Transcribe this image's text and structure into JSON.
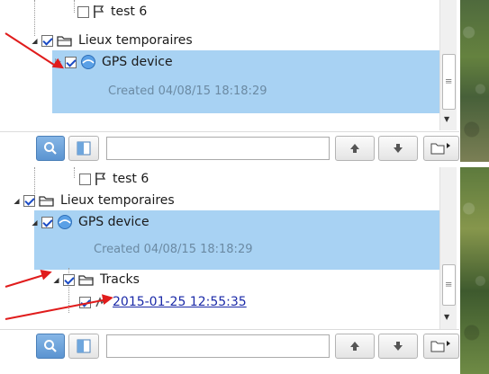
{
  "top": {
    "items": [
      {
        "label": "test 6",
        "checked": false
      },
      {
        "label": "Lieux temporaires",
        "checked": true
      },
      {
        "label": "GPS device",
        "checked": true,
        "subtitle": "Created 04/08/15 18:18:29"
      }
    ]
  },
  "bottom": {
    "items": [
      {
        "label": "test 6",
        "checked": false
      },
      {
        "label": "Lieux temporaires",
        "checked": true
      },
      {
        "label": "GPS device",
        "checked": true,
        "subtitle": "Created 04/08/15 18:18:29"
      },
      {
        "label": "Tracks",
        "checked": true
      },
      {
        "label": "2015-01-25 12:55:35",
        "checked": true
      }
    ]
  },
  "toolbar": {
    "search_value": ""
  },
  "icons": {
    "search": "search-icon",
    "panel": "panel-toggle-icon",
    "up": "arrow-up-icon",
    "down": "arrow-down-icon",
    "folder_menu": "folder-menu-icon",
    "flag": "flag-icon",
    "folder": "folder-icon",
    "gps": "gps-device-icon",
    "track": "track-icon"
  },
  "colors": {
    "selection": "#a8d2f3",
    "annotation_arrow": "#e01c1c",
    "link": "#1b2aa8"
  }
}
